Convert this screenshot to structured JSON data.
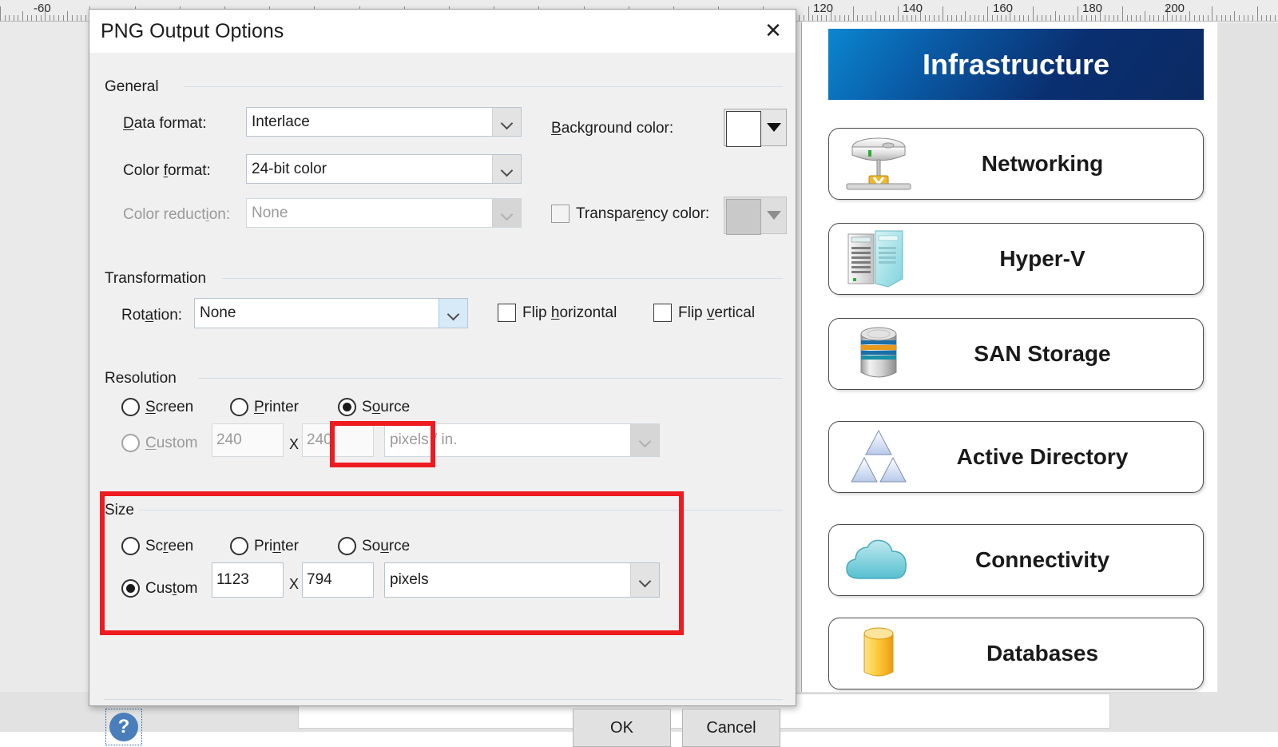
{
  "dialog": {
    "title": "PNG Output Options",
    "close_icon": "close-icon",
    "groups": {
      "general": "General",
      "transformation": "Transformation",
      "resolution": "Resolution",
      "size": "Size"
    },
    "general": {
      "data_format_label": "Data format:",
      "data_format_value": "Interlace",
      "color_format_label": "Color format:",
      "color_format_value": "24-bit color",
      "color_reduction_label": "Color reduction:",
      "color_reduction_value": "None",
      "background_color_label": "Background color:",
      "background_color_value": "#ffffff",
      "transparency_color_label": "Transparency color:",
      "transparency_color_value": "#c9c9c9",
      "transparency_checked": false
    },
    "transformation": {
      "rotation_label": "Rotation:",
      "rotation_value": "None",
      "flip_horizontal_label": "Flip horizontal",
      "flip_horizontal_checked": false,
      "flip_vertical_label": "Flip vertical",
      "flip_vertical_checked": false
    },
    "resolution": {
      "screen_label": "Screen",
      "printer_label": "Printer",
      "source_label": "Source",
      "custom_label": "Custom",
      "selected": "Source",
      "width_value": "240",
      "height_value": "240",
      "x_separator": "X",
      "unit_value": "pixels / in."
    },
    "size": {
      "screen_label": "Screen",
      "printer_label": "Printer",
      "source_label": "Source",
      "custom_label": "Custom",
      "selected": "Custom",
      "width_value": "1123",
      "height_value": "794",
      "x_separator": "X",
      "unit_value": "pixels"
    },
    "footer": {
      "help_label": "?",
      "ok_label": "OK",
      "cancel_label": "Cancel"
    },
    "annotations": {
      "color": "#ee1b20",
      "targets": [
        "resolution-source-radio",
        "size-group"
      ]
    }
  },
  "ruler": {
    "labels": [
      "-60",
      "120",
      "140",
      "160",
      "180",
      "200"
    ]
  },
  "diagram": {
    "banner_title": "Infrastructure",
    "banner_gradient_from": "#0b86d0",
    "banner_gradient_to": "#0b2a63",
    "shapes": [
      {
        "label": "Networking",
        "icon": "network-device-icon"
      },
      {
        "label": "Hyper-V",
        "icon": "servers-icon"
      },
      {
        "label": "SAN Storage",
        "icon": "san-storage-cylinder-icon"
      },
      {
        "label": "Active Directory",
        "icon": "triangles-icon"
      },
      {
        "label": "Connectivity",
        "icon": "cloud-icon"
      },
      {
        "label": "Databases",
        "icon": "database-cylinder-icon"
      }
    ]
  }
}
